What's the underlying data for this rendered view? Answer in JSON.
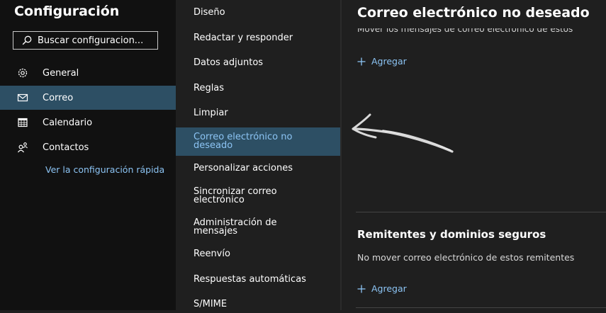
{
  "sidebar": {
    "title": "Configuración",
    "search_placeholder": "Buscar configuracion...",
    "items": [
      {
        "label": "General",
        "icon": "gear-icon"
      },
      {
        "label": "Correo",
        "icon": "mail-icon",
        "active": true
      },
      {
        "label": "Calendario",
        "icon": "calendar-icon"
      },
      {
        "label": "Contactos",
        "icon": "people-icon"
      }
    ],
    "quick_settings_link": "Ver la configuración rápida"
  },
  "submenu": {
    "items": [
      {
        "label": "Diseño"
      },
      {
        "label": "Redactar y responder"
      },
      {
        "label": "Datos adjuntos"
      },
      {
        "label": "Reglas"
      },
      {
        "label": "Limpiar"
      },
      {
        "label": "Correo electrónico no deseado",
        "active": true
      },
      {
        "label": "Personalizar acciones"
      },
      {
        "label": "Sincronizar correo electrónico"
      },
      {
        "label": "Administración de mensajes"
      },
      {
        "label": "Reenvío"
      },
      {
        "label": "Respuestas automáticas"
      },
      {
        "label": "S/MIME"
      }
    ]
  },
  "main": {
    "title": "Correo electrónico no deseado",
    "blocked_description": "Mover los mensajes de correo electrónico de estos",
    "add_label": "Agregar",
    "safe_section": {
      "title": "Remitentes y dominios seguros",
      "description": "No mover correo electrónico de estos remitentes",
      "add_label": "Agregar"
    }
  },
  "colors": {
    "sidebar_bg": "#111111",
    "panel_bg": "#1f1f1f",
    "active_bg": "#2d4f64",
    "link": "#8cc4f4"
  }
}
